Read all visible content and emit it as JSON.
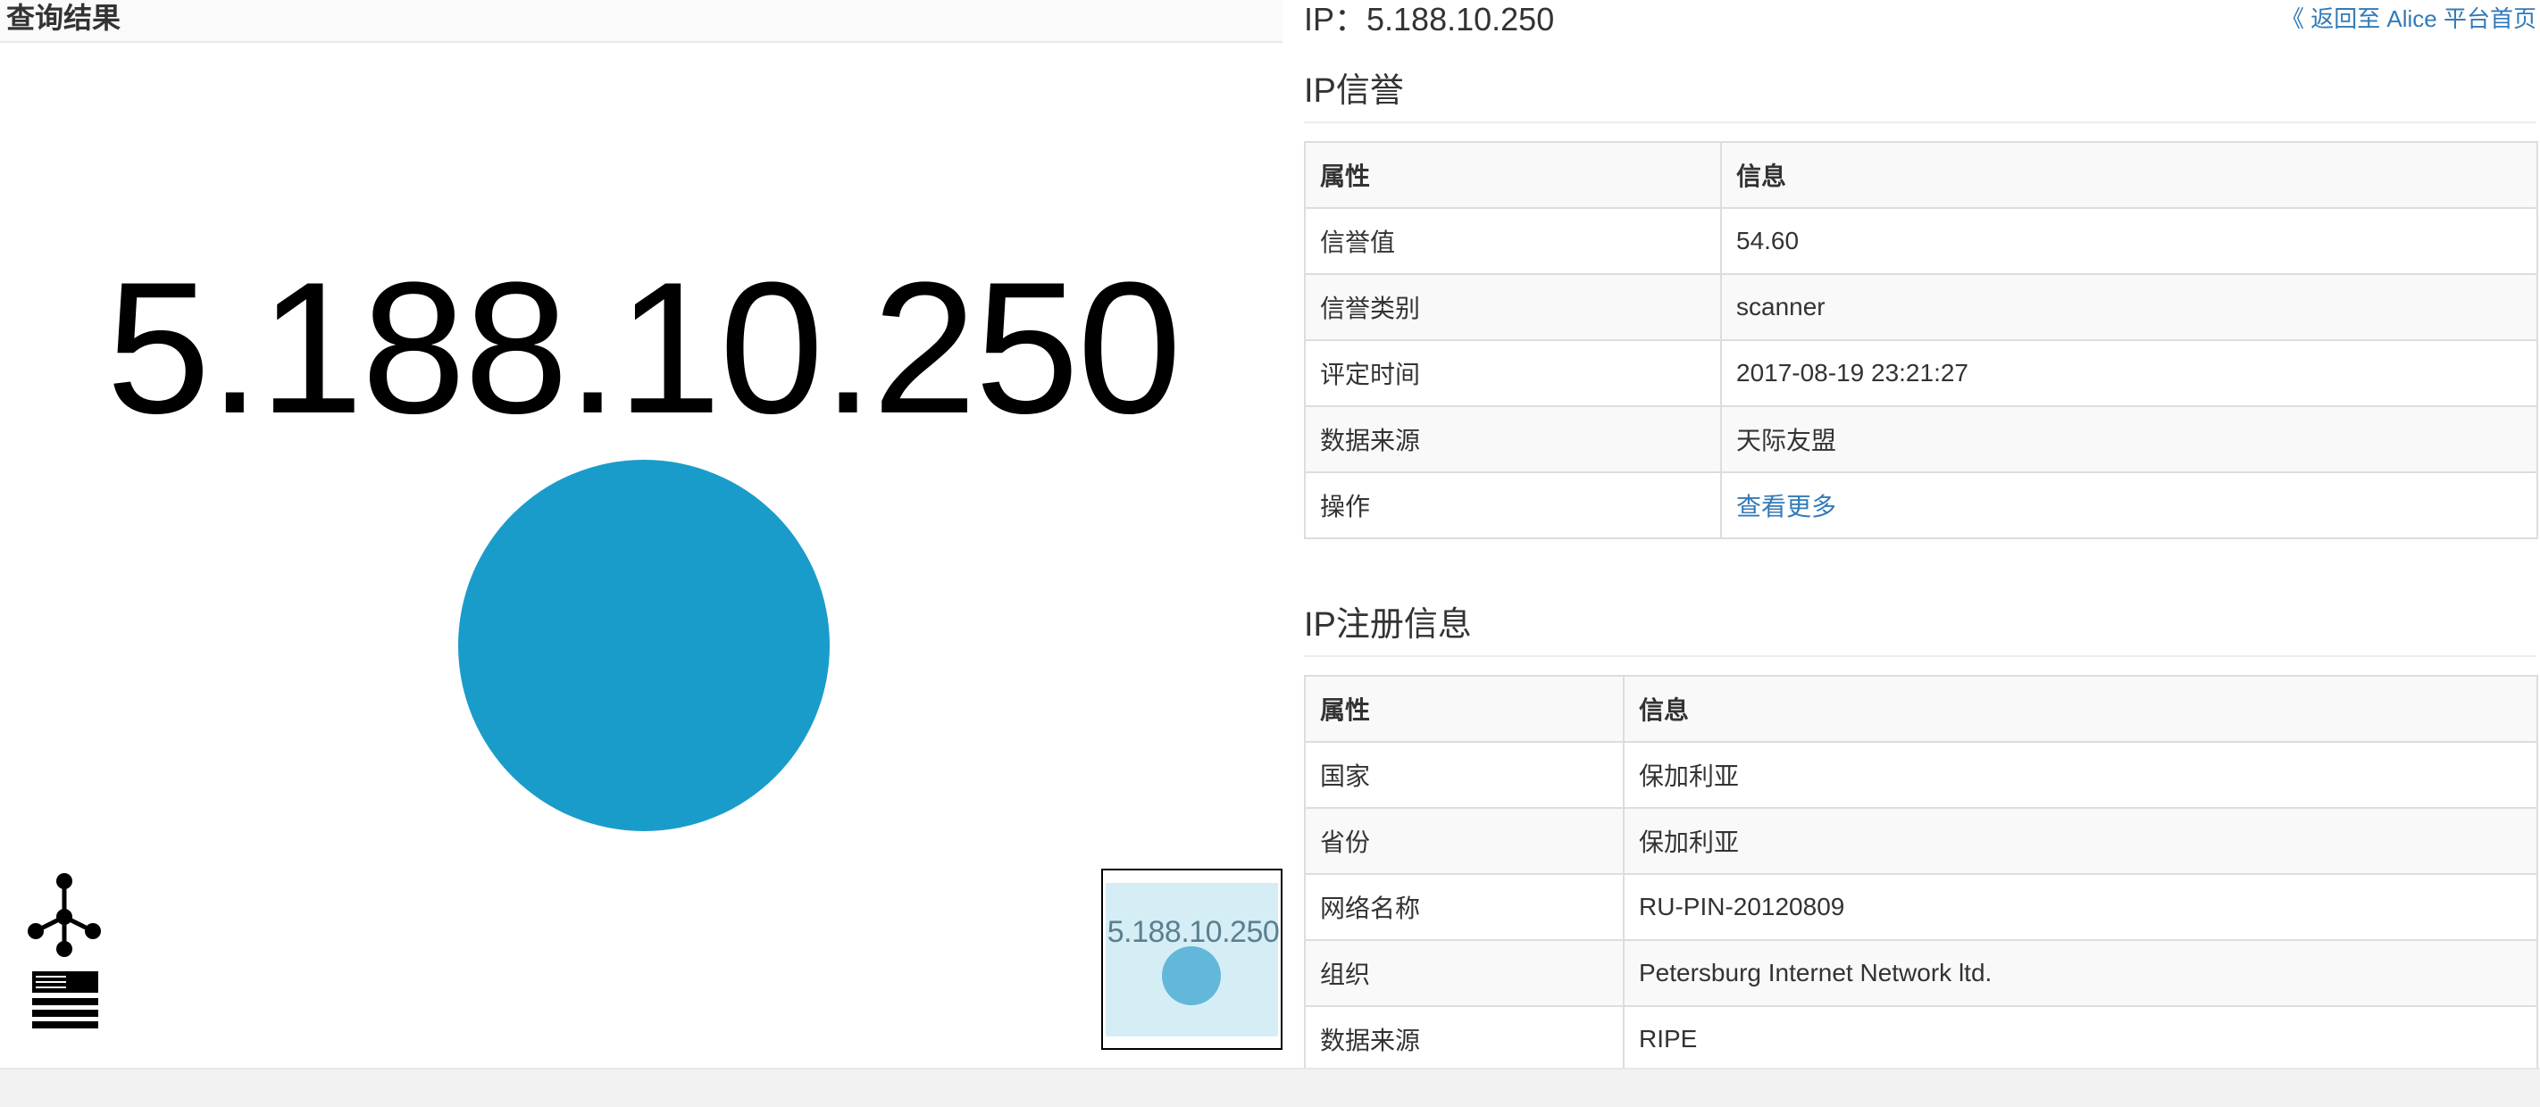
{
  "left": {
    "title": "查询结果",
    "graph": {
      "node_label": "5.188.10.250",
      "node_color": "#1a9ccb"
    },
    "tools": [
      "graph-layout-icon",
      "list-view-icon"
    ],
    "minimap": {
      "node_label": "5.188.10.250"
    }
  },
  "header": {
    "ip_heading": "IP：5.188.10.250",
    "back_link": "《 返回至 Alice 平台首页"
  },
  "reputation": {
    "title": "IP信誉",
    "columns": [
      "属性",
      "信息"
    ],
    "rows": [
      {
        "attr": "信誉值",
        "value": "54.60"
      },
      {
        "attr": "信誉类别",
        "value": "scanner"
      },
      {
        "attr": "评定时间",
        "value": "2017-08-19 23:21:27"
      },
      {
        "attr": "数据来源",
        "value": "天际友盟"
      },
      {
        "attr": "操作",
        "value": "查看更多"
      }
    ]
  },
  "registration": {
    "title": "IP注册信息",
    "columns": [
      "属性",
      "信息"
    ],
    "rows": [
      {
        "attr": "国家",
        "value": "保加利亚"
      },
      {
        "attr": "省份",
        "value": "保加利亚"
      },
      {
        "attr": "网络名称",
        "value": "RU-PIN-20120809"
      },
      {
        "attr": "组织",
        "value": "Petersburg Internet Network ltd."
      },
      {
        "attr": "数据来源",
        "value": "RIPE"
      }
    ]
  },
  "colors": {
    "accent": "#1a9ccb",
    "link": "#337ab7"
  }
}
